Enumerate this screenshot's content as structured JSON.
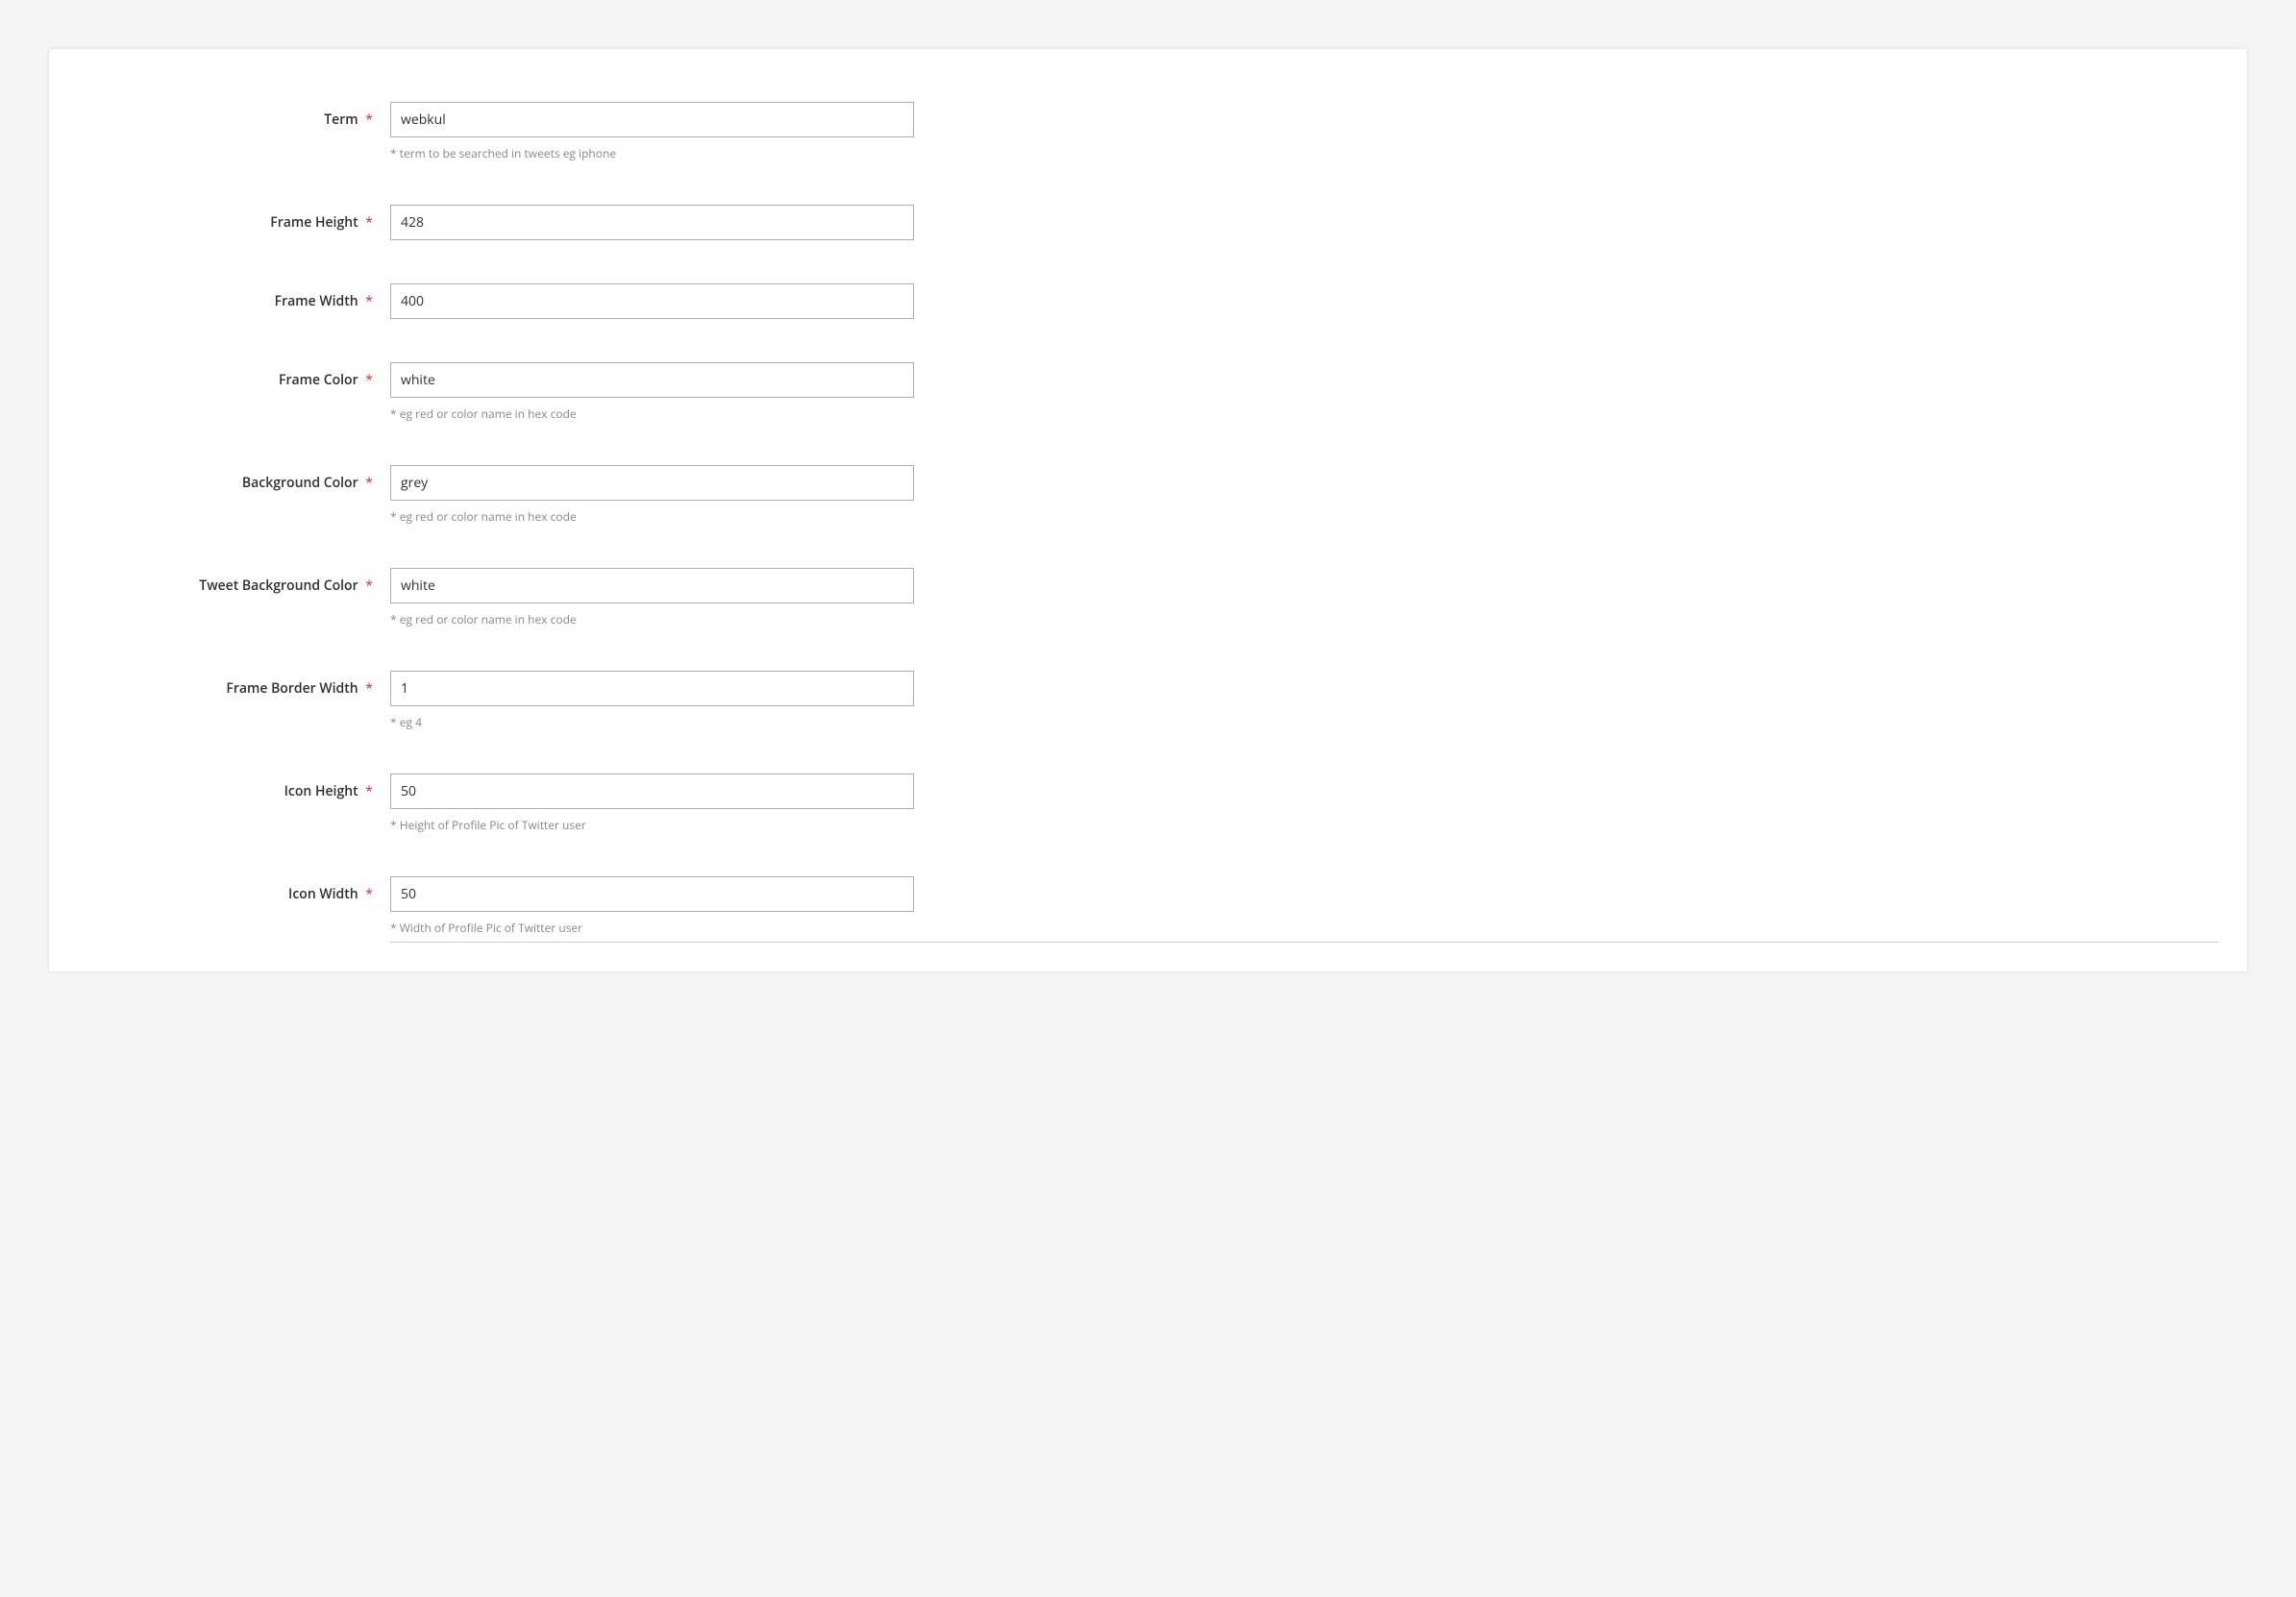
{
  "fields": {
    "term": {
      "label": "Term",
      "value": "webkul",
      "hint": "* term to be searched in tweets eg iphone"
    },
    "frame_height": {
      "label": "Frame Height",
      "value": "428"
    },
    "frame_width": {
      "label": "Frame Width",
      "value": "400"
    },
    "frame_color": {
      "label": "Frame Color",
      "value": "white",
      "hint": "* eg red or color name in hex code"
    },
    "background_color": {
      "label": "Background Color",
      "value": "grey",
      "hint": "* eg red or color name in hex code"
    },
    "tweet_background_color": {
      "label": "Tweet Background Color",
      "value": "white",
      "hint": "* eg red or color name in hex code"
    },
    "frame_border_width": {
      "label": "Frame Border Width",
      "value": "1",
      "hint": "* eg 4"
    },
    "icon_height": {
      "label": "Icon Height",
      "value": "50",
      "hint": "* Height of Profile Pic of Twitter user"
    },
    "icon_width": {
      "label": "Icon Width",
      "value": "50",
      "hint": "* Width of Profile Pic of Twitter user"
    }
  },
  "required_marker": "*"
}
